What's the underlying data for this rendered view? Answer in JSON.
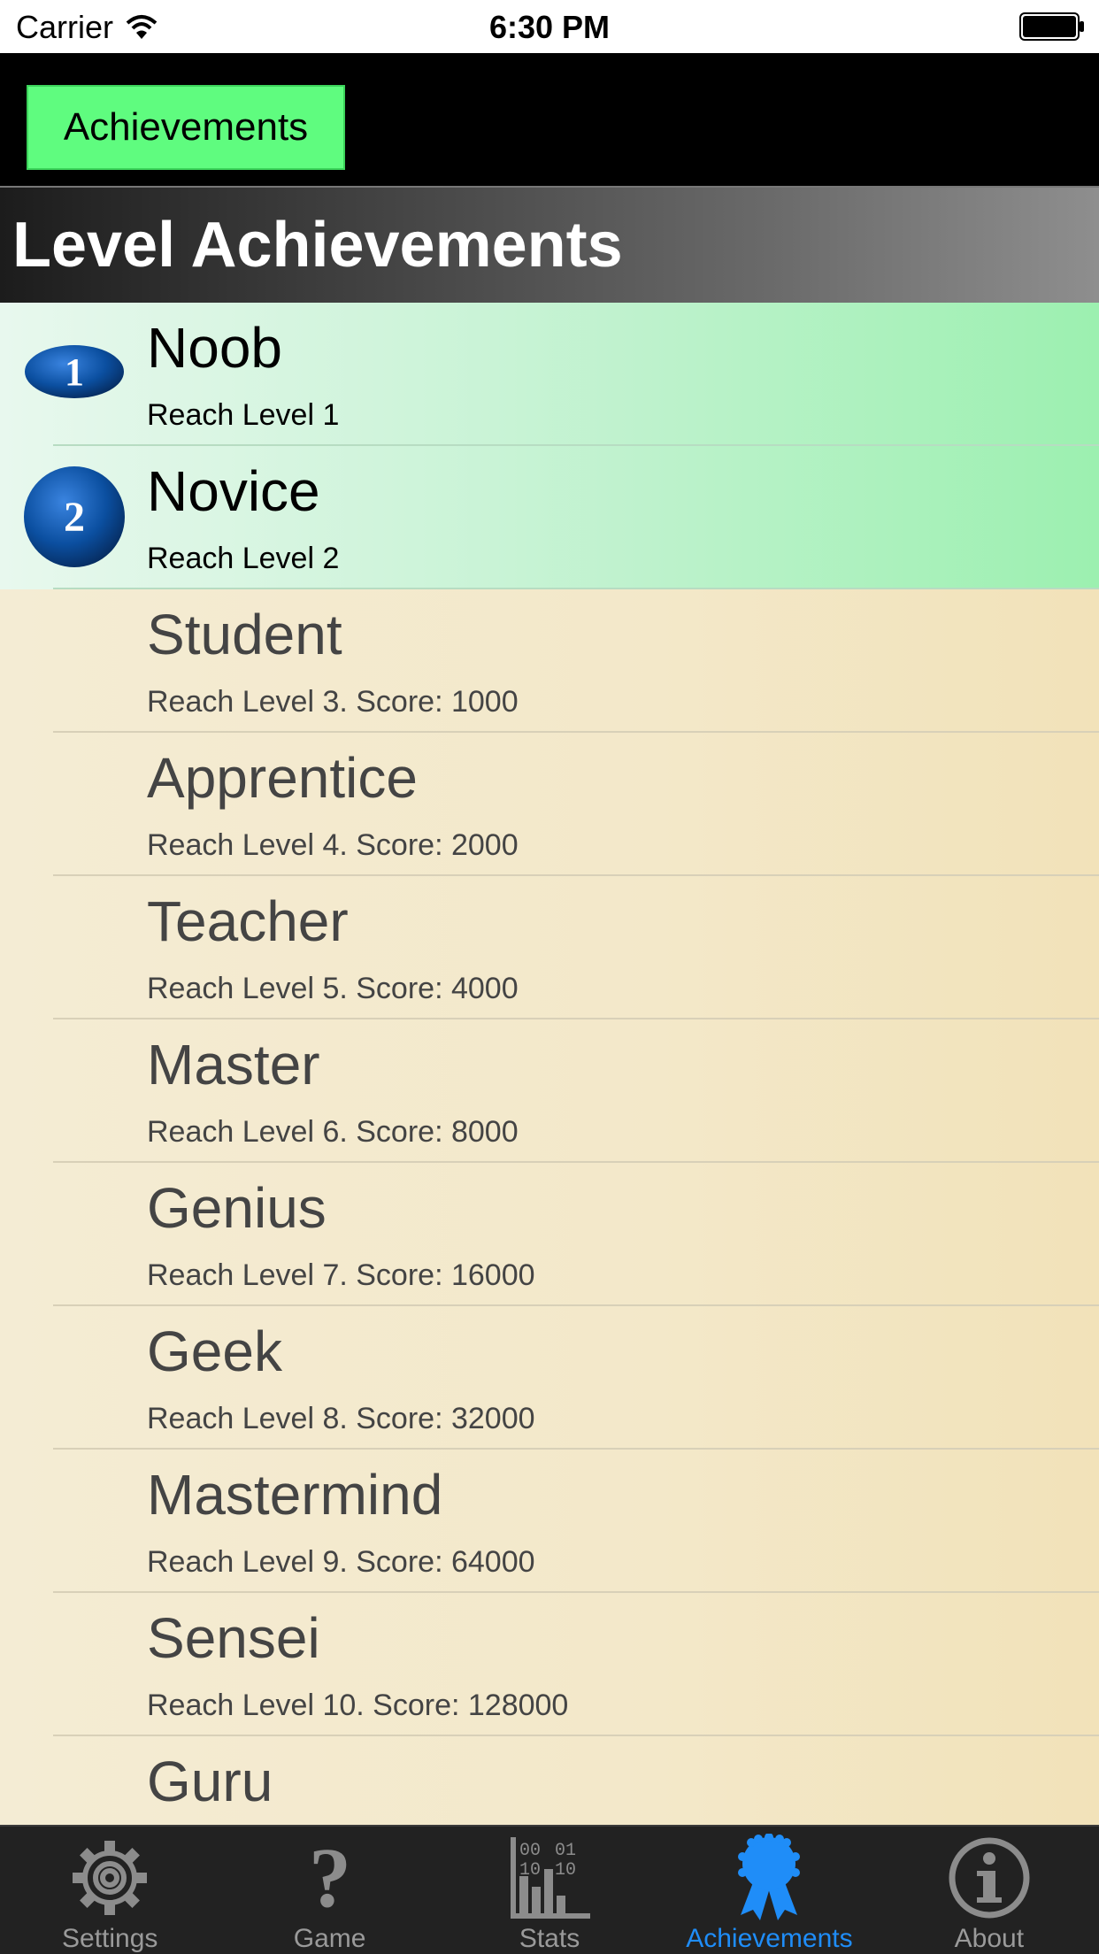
{
  "status_bar": {
    "carrier": "Carrier",
    "time": "6:30 PM"
  },
  "nav": {
    "button_label": "Achievements"
  },
  "section": {
    "title": "Level Achievements"
  },
  "achievements": [
    {
      "title": "Noob",
      "subtitle": "Reach Level 1",
      "unlocked": true,
      "badge": "1"
    },
    {
      "title": "Novice",
      "subtitle": "Reach Level 2",
      "unlocked": true,
      "badge": "2"
    },
    {
      "title": "Student",
      "subtitle": "Reach Level 3. Score: 1000",
      "unlocked": false
    },
    {
      "title": "Apprentice",
      "subtitle": "Reach Level 4. Score: 2000",
      "unlocked": false
    },
    {
      "title": "Teacher",
      "subtitle": "Reach Level 5. Score: 4000",
      "unlocked": false
    },
    {
      "title": "Master",
      "subtitle": "Reach Level 6. Score: 8000",
      "unlocked": false
    },
    {
      "title": "Genius",
      "subtitle": "Reach Level 7. Score: 16000",
      "unlocked": false
    },
    {
      "title": "Geek",
      "subtitle": "Reach Level 8. Score: 32000",
      "unlocked": false
    },
    {
      "title": "Mastermind",
      "subtitle": "Reach Level 9. Score: 64000",
      "unlocked": false
    },
    {
      "title": "Sensei",
      "subtitle": "Reach Level 10. Score: 128000",
      "unlocked": false
    },
    {
      "title": "Guru",
      "subtitle": "",
      "unlocked": false
    }
  ],
  "tabs": [
    {
      "label": "Settings",
      "icon": "gear-icon",
      "active": false
    },
    {
      "label": "Game",
      "icon": "question-icon",
      "active": false
    },
    {
      "label": "Stats",
      "icon": "stats-icon",
      "active": false
    },
    {
      "label": "Achievements",
      "icon": "ribbon-icon",
      "active": true
    },
    {
      "label": "About",
      "icon": "info-icon",
      "active": false
    }
  ],
  "colors": {
    "nav_button": "#5ffc7f",
    "active_tab": "#1f8df8",
    "inactive_tab": "#9a9a9a",
    "badge_blue": "#0b4fa0"
  }
}
